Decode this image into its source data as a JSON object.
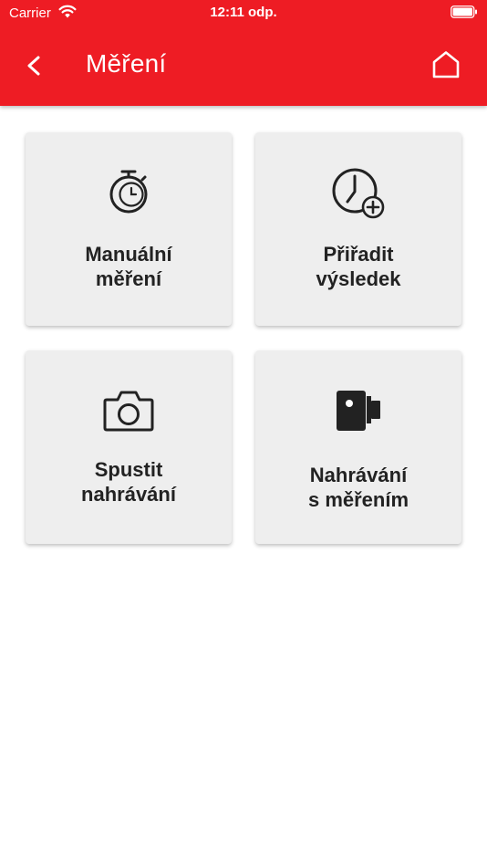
{
  "status_bar": {
    "carrier": "Carrier",
    "time": "12:11 odp."
  },
  "header": {
    "title": "Měření",
    "background": "#ee1c24"
  },
  "tiles": [
    {
      "line1": "Manuální",
      "line2": "měření",
      "icon": "stopwatch-icon"
    },
    {
      "line1": "Přiřadit",
      "line2": "výsledek",
      "icon": "clock-add-icon"
    },
    {
      "line1": "Spustit",
      "line2": "nahrávání",
      "icon": "camera-icon"
    },
    {
      "line1": "Nahrávání",
      "line2": "s měřením",
      "icon": "camera-device-icon"
    }
  ]
}
